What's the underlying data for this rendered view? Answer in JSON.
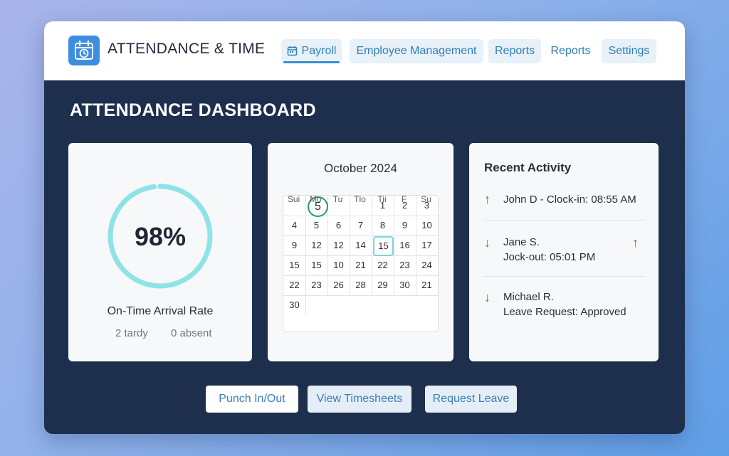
{
  "app": {
    "title": "ATTENDANCE & TIME",
    "logo_icon": "calendar-clock-icon"
  },
  "nav": {
    "tabs": [
      {
        "label": "Payroll",
        "icon": "calendar-icon",
        "active": true
      },
      {
        "label": "Employee Management"
      },
      {
        "label": "Reports"
      },
      {
        "label": "Reports"
      },
      {
        "label": "Settings"
      }
    ]
  },
  "page": {
    "title": "ATTENDANCE DASHBOARD"
  },
  "rate_card": {
    "value": "98%",
    "percent": 98,
    "label": "On-Time Arrival Rate",
    "tardy": "2 tardy",
    "absent": "0 absent",
    "ring_color": "#8fe3e6"
  },
  "calendar": {
    "title": "October 2024",
    "weekdays": [
      "Sui",
      "Mo",
      "Tu",
      "Tlo",
      "Tii",
      "F",
      "Su"
    ],
    "rows": [
      [
        "",
        "5",
        "",
        "",
        "1",
        "2",
        "3"
      ],
      [
        "4",
        "5",
        "6",
        "7",
        "8",
        "9",
        "10"
      ],
      [
        "9",
        "12",
        "12",
        "14",
        "15",
        "16",
        "17"
      ],
      [
        "15",
        "15",
        "10",
        "21",
        "22",
        "23",
        "24"
      ],
      [
        "22",
        "23",
        "26",
        "28",
        "29",
        "30",
        "21"
      ],
      [
        "30",
        "",
        "",
        "",
        "",
        "",
        ""
      ]
    ],
    "today_color": "#1fa355",
    "selected_color": "#7cd6da"
  },
  "activity": {
    "title": "Recent Activity",
    "items": [
      {
        "line1": "John D - Clock-in: 08:55 AM",
        "line2": "",
        "direction": "up",
        "color": "#1fa355"
      },
      {
        "line1": "Jane S.",
        "line2": "Jock-out: 05:01 PM",
        "direction": "down",
        "color": "#1fa355",
        "flag_direction": "up",
        "flag_color": "#e0443a"
      },
      {
        "line1": "Michael R.",
        "line2": "Leave Request: Approved",
        "direction": "down",
        "color": "#1fa355"
      }
    ]
  },
  "actions": {
    "punch": "Punch In/Out",
    "timesheets": "View Timesheets",
    "leave": "Request Leave"
  }
}
